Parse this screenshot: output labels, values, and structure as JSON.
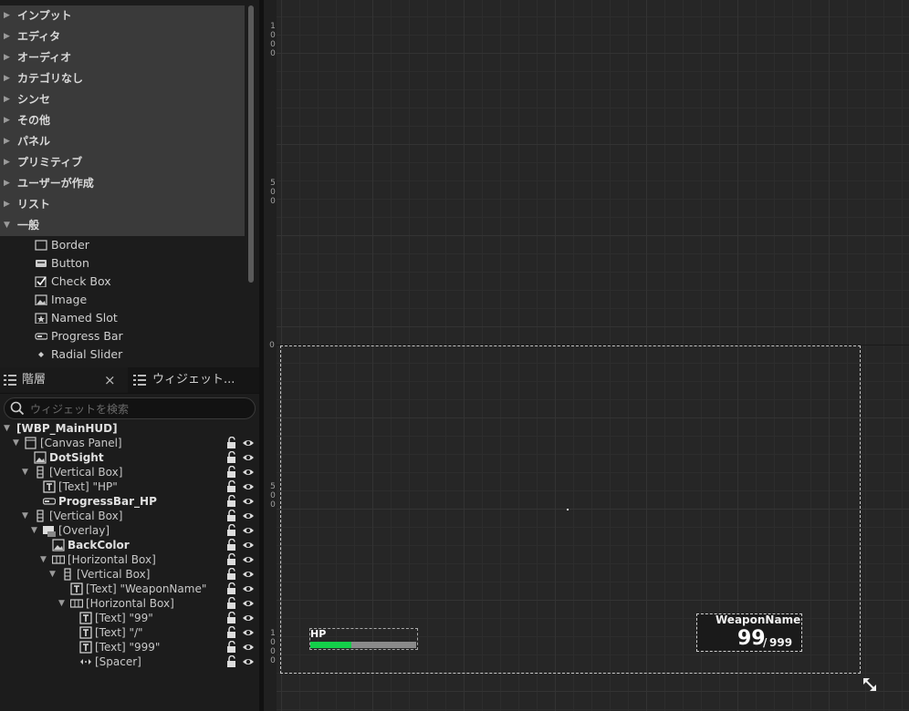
{
  "palette": {
    "categories": [
      "インプット",
      "エディタ",
      "オーディオ",
      "カテゴリなし",
      "シンセ",
      "その他",
      "パネル",
      "プリミティブ",
      "ユーザーが作成",
      "リスト",
      "一般"
    ],
    "items": [
      "Border",
      "Button",
      "Check Box",
      "Image",
      "Named Slot",
      "Progress Bar",
      "Radial Slider"
    ]
  },
  "tabs": {
    "hierarchy": "階層",
    "widgets": "ウィジェット..."
  },
  "search": {
    "placeholder": "ウィジェットを検索"
  },
  "hierarchy": [
    {
      "label": "[WBP_MainHUD]",
      "icon": "none-icon",
      "bold": true
    },
    {
      "label": "[Canvas Panel]",
      "icon": "canvas-panel-icon",
      "bold": false
    },
    {
      "label": "DotSight",
      "icon": "image-icon",
      "bold": true
    },
    {
      "label": "[Vertical Box]",
      "icon": "vertical-box-icon",
      "bold": false
    },
    {
      "label": "[Text] \"HP\"",
      "icon": "text-icon",
      "bold": false
    },
    {
      "label": "ProgressBar_HP",
      "icon": "progress-bar-icon",
      "bold": true
    },
    {
      "label": "[Vertical Box]",
      "icon": "vertical-box-icon",
      "bold": false
    },
    {
      "label": "[Overlay]",
      "icon": "overlay-icon",
      "bold": false
    },
    {
      "label": "BackColor",
      "icon": "image-icon",
      "bold": true
    },
    {
      "label": "[Horizontal Box]",
      "icon": "horizontal-box-icon",
      "bold": false
    },
    {
      "label": "[Vertical Box]",
      "icon": "vertical-box-icon",
      "bold": false
    },
    {
      "label": "[Text] \"WeaponName\"",
      "icon": "text-icon",
      "bold": false
    },
    {
      "label": "[Horizontal Box]",
      "icon": "horizontal-box-icon",
      "bold": false
    },
    {
      "label": "[Text] \"99\"",
      "icon": "text-icon",
      "bold": false
    },
    {
      "label": "[Text] \"/\"",
      "icon": "text-icon",
      "bold": false
    },
    {
      "label": "[Text] \"999\"",
      "icon": "text-icon",
      "bold": false
    },
    {
      "label": "[Spacer]",
      "icon": "spacer-icon",
      "bold": false
    }
  ],
  "ruler": {
    "mark_1000": "1000",
    "mark_500a": "500",
    "mark_0": "0",
    "mark_500b": "500",
    "mark_1000b": "1000"
  },
  "hud": {
    "hp_label": "HP",
    "hp_fraction": 0.39,
    "weapon_name": "WeaponName",
    "ammo_current": "99",
    "ammo_slash": "/",
    "ammo_max": "999"
  },
  "colors": {
    "hp_fill": "#14d04a",
    "panel_bg": "#1c1c1c",
    "category_bg": "#3a3a3a"
  }
}
